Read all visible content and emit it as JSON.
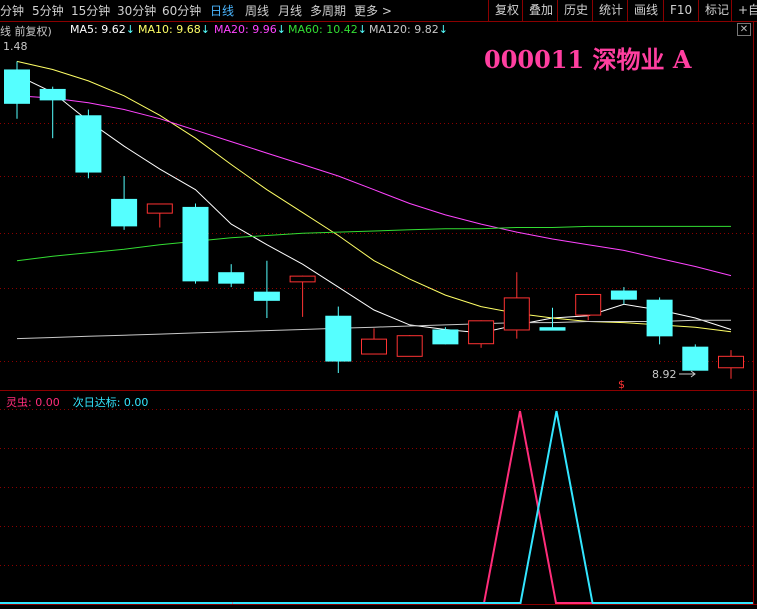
{
  "toolbar": {
    "periods": [
      {
        "label": "分钟",
        "active": false
      },
      {
        "label": "5分钟",
        "active": false
      },
      {
        "label": "15分钟",
        "active": false
      },
      {
        "label": "30分钟",
        "active": false
      },
      {
        "label": "60分钟",
        "active": false
      },
      {
        "label": "日线",
        "active": true
      },
      {
        "label": "周线",
        "active": false
      },
      {
        "label": "月线",
        "active": false
      },
      {
        "label": "多周期",
        "active": false
      },
      {
        "label": "更多 >",
        "active": false
      }
    ],
    "tools": [
      "复权",
      "叠加",
      "历史",
      "统计",
      "画线",
      "F10",
      "标记",
      "+自选"
    ]
  },
  "ma_header": {
    "mode_label": "线 前复权)",
    "items": [
      {
        "label": "MA5: 9.62",
        "arrow": "↓",
        "color": "#ffffff"
      },
      {
        "label": "MA10: 9.68",
        "arrow": "↓",
        "color": "#ffff66"
      },
      {
        "label": "MA20: 9.96",
        "arrow": "↓",
        "color": "#ff44ff"
      },
      {
        "label": "MA60: 10.42",
        "arrow": "↓",
        "color": "#33dd33"
      },
      {
        "label": "MA120: 9.82",
        "arrow": "↓",
        "color": "#c8c8c8"
      }
    ]
  },
  "stock": {
    "code": "000011",
    "name": "深物业 A",
    "title": "000011  深物业 A"
  },
  "indicator": {
    "items": [
      {
        "label": "灵虫: 0.00",
        "color": "#ff2d7a"
      },
      {
        "label": "次日达标: 0.00",
        "color": "#33e6ff"
      }
    ]
  },
  "colors": {
    "up": "#ff3333",
    "down": "#55ffff",
    "grid": "#8b0000",
    "background": "#000000"
  },
  "chart_data": [
    {
      "type": "candlestick",
      "title": "",
      "price_labels": {
        "high": "1.48",
        "low": "8.92"
      },
      "ylim": [
        8.8,
        11.55
      ],
      "candles": [
        {
          "o": 11.45,
          "h": 11.52,
          "l": 11.02,
          "c": 11.15
        },
        {
          "o": 11.28,
          "h": 11.3,
          "l": 10.85,
          "c": 11.18
        },
        {
          "o": 11.05,
          "h": 11.1,
          "l": 10.5,
          "c": 10.55
        },
        {
          "o": 10.32,
          "h": 10.52,
          "l": 10.05,
          "c": 10.08
        },
        {
          "o": 10.2,
          "h": 10.25,
          "l": 10.07,
          "c": 10.28
        },
        {
          "o": 10.25,
          "h": 10.28,
          "l": 9.58,
          "c": 9.6
        },
        {
          "o": 9.68,
          "h": 9.75,
          "l": 9.55,
          "c": 9.58
        },
        {
          "o": 9.51,
          "h": 9.78,
          "l": 9.28,
          "c": 9.43
        },
        {
          "o": 9.6,
          "h": 9.65,
          "l": 9.29,
          "c": 9.65
        },
        {
          "o": 9.3,
          "h": 9.38,
          "l": 8.8,
          "c": 8.9
        },
        {
          "o": 8.97,
          "h": 9.19,
          "l": 8.97,
          "c": 9.1
        },
        {
          "o": 8.95,
          "h": 9.13,
          "l": 8.95,
          "c": 9.13
        },
        {
          "o": 9.18,
          "h": 9.2,
          "l": 9.05,
          "c": 9.05
        },
        {
          "o": 9.06,
          "h": 9.26,
          "l": 9.02,
          "c": 9.26
        },
        {
          "o": 9.18,
          "h": 9.68,
          "l": 9.1,
          "c": 9.46
        },
        {
          "o": 9.2,
          "h": 9.37,
          "l": 9.19,
          "c": 9.17
        },
        {
          "o": 9.31,
          "h": 9.49,
          "l": 9.26,
          "c": 9.49
        },
        {
          "o": 9.52,
          "h": 9.55,
          "l": 9.4,
          "c": 9.44
        },
        {
          "o": 9.44,
          "h": 9.46,
          "l": 9.05,
          "c": 9.12
        },
        {
          "o": 9.03,
          "h": 9.05,
          "l": 8.92,
          "c": 8.82
        },
        {
          "o": 8.85,
          "h": 9.0,
          "l": 8.75,
          "c": 8.95
        }
      ],
      "ma_lines": [
        {
          "name": "MA5",
          "color": "#ffffff",
          "values": [
            11.4,
            11.25,
            11.0,
            10.78,
            10.58,
            10.4,
            10.1,
            9.92,
            9.75,
            9.55,
            9.35,
            9.22,
            9.18,
            9.15,
            9.22,
            9.28,
            9.3,
            9.4,
            9.35,
            9.28,
            9.18
          ]
        },
        {
          "name": "MA10",
          "color": "#ffff66",
          "values": [
            11.52,
            11.45,
            11.35,
            11.22,
            11.05,
            10.85,
            10.62,
            10.4,
            10.2,
            10.0,
            9.78,
            9.62,
            9.48,
            9.38,
            9.32,
            9.28,
            9.25,
            9.24,
            9.22,
            9.2,
            9.16
          ]
        },
        {
          "name": "MA20",
          "color": "#ff44ff",
          "values": [
            11.22,
            11.2,
            11.16,
            11.1,
            11.02,
            10.92,
            10.82,
            10.72,
            10.62,
            10.52,
            10.4,
            10.28,
            10.18,
            10.1,
            10.03,
            9.97,
            9.92,
            9.87,
            9.8,
            9.73,
            9.65
          ]
        },
        {
          "name": "MA60",
          "color": "#33dd33",
          "values": [
            9.78,
            9.82,
            9.85,
            9.88,
            9.92,
            9.95,
            9.98,
            10.0,
            10.02,
            10.03,
            10.04,
            10.05,
            10.06,
            10.06,
            10.07,
            10.07,
            10.08,
            10.08,
            10.08,
            10.08,
            10.08
          ]
        },
        {
          "name": "MA120",
          "color": "#c8c8c8",
          "values": [
            9.1,
            9.11,
            9.12,
            9.13,
            9.14,
            9.15,
            9.16,
            9.17,
            9.18,
            9.19,
            9.2,
            9.21,
            9.22,
            9.23,
            9.24,
            9.24,
            9.25,
            9.25,
            9.25,
            9.26,
            9.26
          ]
        }
      ]
    },
    {
      "type": "line",
      "title": "",
      "ylim": [
        0,
        1
      ],
      "series": [
        {
          "name": "灵虫",
          "color": "#ff2d7a",
          "values": [
            0,
            0,
            0,
            0,
            0,
            0,
            0,
            0,
            1,
            0,
            0
          ]
        },
        {
          "name": "次日达标",
          "color": "#33e6ff",
          "values": [
            0,
            0,
            0,
            0,
            0,
            0,
            0,
            0,
            0,
            1,
            0
          ]
        }
      ]
    }
  ]
}
